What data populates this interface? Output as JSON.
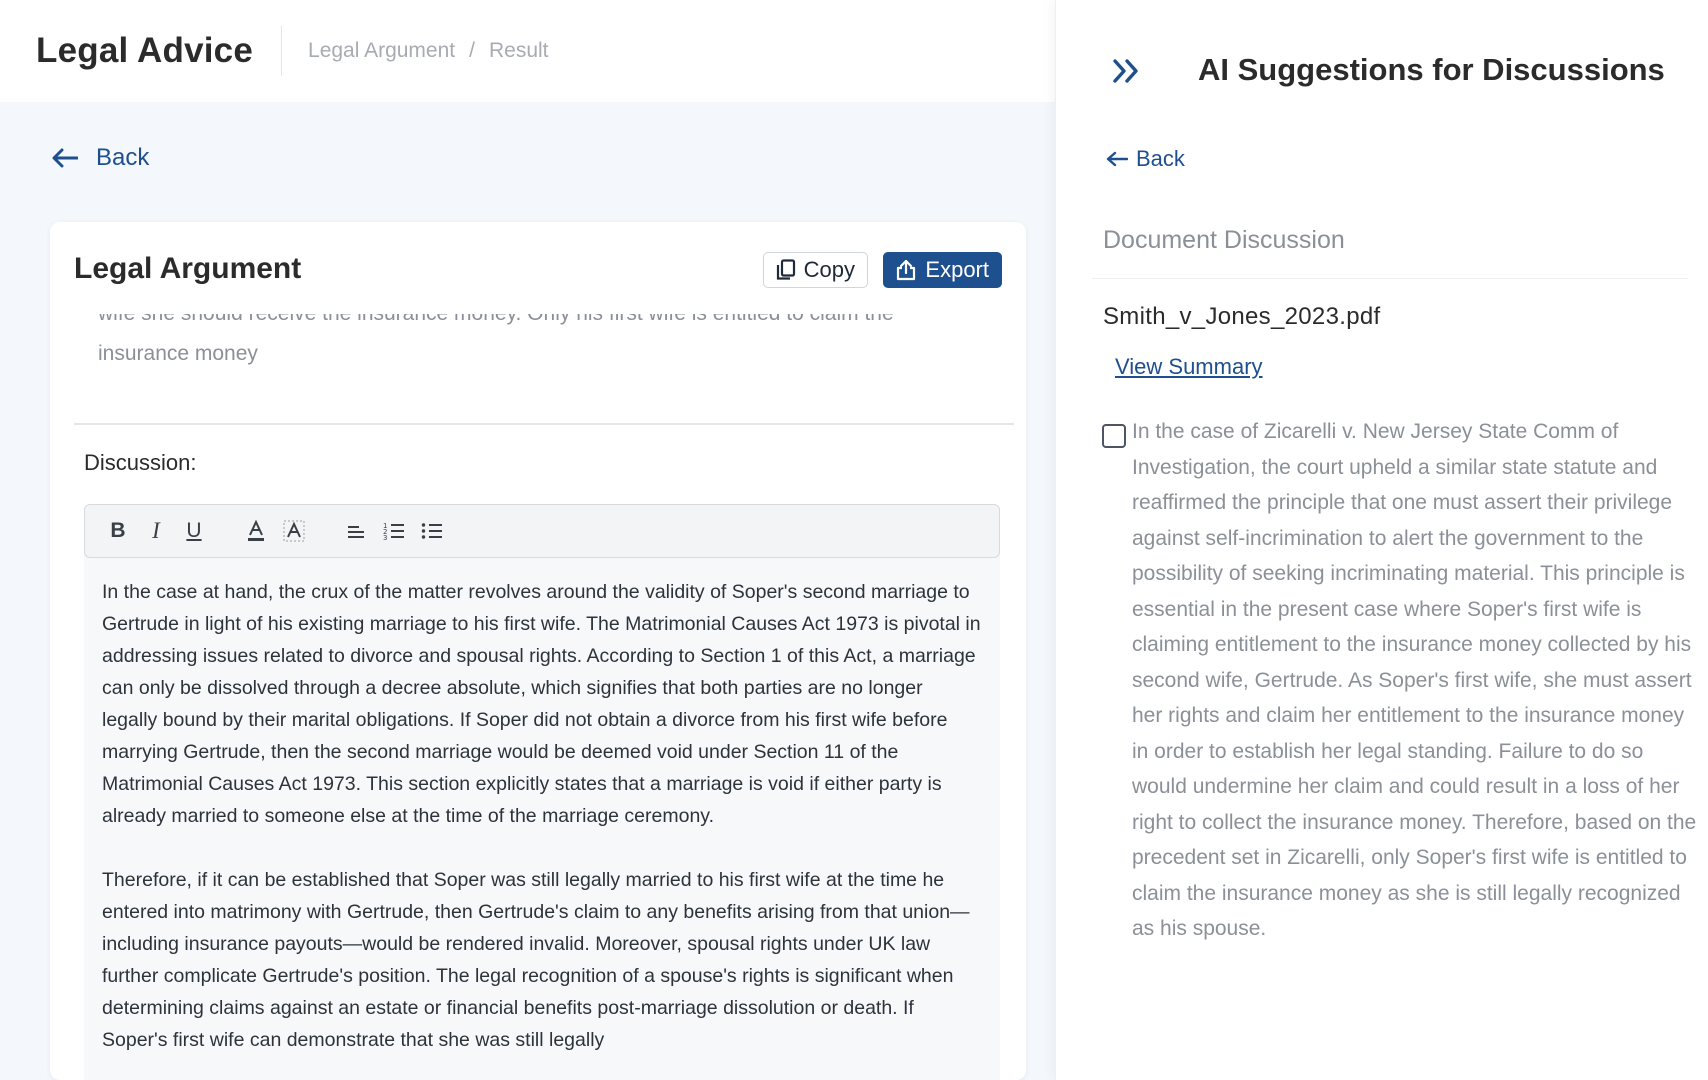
{
  "header": {
    "app_title": "Legal Advice",
    "breadcrumb": [
      "Legal Argument",
      "Result"
    ]
  },
  "left": {
    "back_label": "Back",
    "card_title": "Legal Argument",
    "copy_label": "Copy",
    "export_label": "Export",
    "argument_clipped_line": "wife she should receive the insurance money. Only his first wife is entitled to claim the",
    "argument_tail": "insurance money",
    "discussion_label": "Discussion:",
    "toolbar_icons": [
      "bold-icon",
      "italic-icon",
      "underline-icon",
      "font-color-icon",
      "highlight-icon",
      "align-left-icon",
      "ordered-list-icon",
      "bullet-list-icon"
    ],
    "discussion_paragraphs": [
      "In the case at hand, the crux of the matter revolves around the validity of Soper's second marriage to Gertrude in light of his existing marriage to his first wife. The Matrimonial Causes Act 1973 is pivotal in addressing issues related to divorce and spousal rights. According to Section 1 of this Act, a marriage can only be dissolved through a decree absolute, which signifies that both parties are no longer legally bound by their marital obligations. If Soper did not obtain a divorce from his first wife before marrying Gertrude, then the second marriage would be deemed void under Section 11 of the Matrimonial Causes Act 1973. This section explicitly states that a marriage is void if either party is already married to someone else at the time of the marriage ceremony.",
      "Therefore, if it can be established that Soper was still legally married to his first wife at the time he entered into matrimony with Gertrude, then Gertrude's claim to any benefits arising from that union—including insurance payouts—would be rendered invalid. Moreover, spousal rights under UK law further complicate Gertrude's position. The legal recognition of a spouse's rights is significant when determining claims against an estate or financial benefits post-marriage dissolution or death. If Soper's first wife can demonstrate that she was still legally"
    ]
  },
  "right": {
    "title": "AI Suggestions for Discussions",
    "back_label": "Back",
    "section_label": "Document Discussion",
    "file_name": "Smith_v_Jones_2023.pdf",
    "view_summary_label": "View Summary",
    "suggestion_text": "In the case of Zicarelli v. New Jersey State Comm of Investigation, the court upheld a similar state statute and reaffirmed the principle that one must assert their privilege against self-incrimination to alert the government to the possibility of seeking incriminating material. This principle is essential in the present case where Soper's first wife is claiming entitlement to the insurance money collected by his second wife, Gertrude. As Soper's first wife, she must assert her rights and claim her entitlement to the insurance money in order to establish her legal standing. Failure to do so would undermine her claim and could result in a loss of her right to collect the insurance money. Therefore, based on the precedent set in Zicarelli, only Soper's first wife is entitled to claim the insurance money as she is still legally recognized as his spouse."
  },
  "colors": {
    "accent": "#1e4f8f",
    "muted_text": "#8b9098",
    "panel_bg": "#f4f7fb"
  }
}
